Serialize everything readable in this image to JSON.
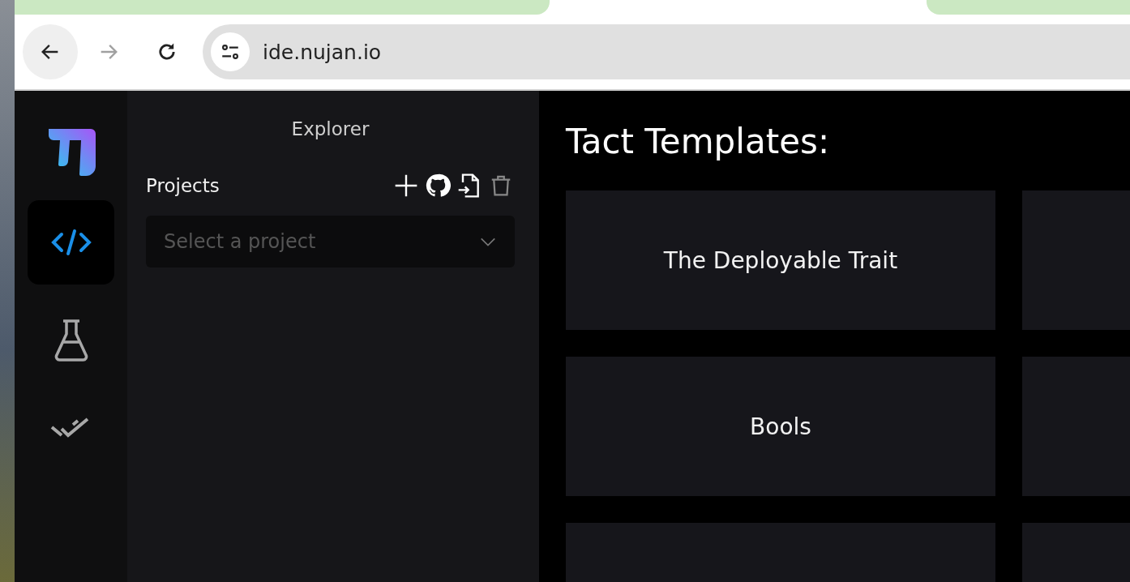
{
  "browser": {
    "back": {
      "disabled": false
    },
    "forward": {
      "disabled": true
    },
    "url": "ide.nujan.io"
  },
  "rail": {
    "items": [
      {
        "kind": "code",
        "selected": true
      },
      {
        "kind": "test",
        "selected": false
      },
      {
        "kind": "check",
        "selected": false
      }
    ]
  },
  "explorer": {
    "title": "Explorer",
    "projects_label": "Projects",
    "project_select": {
      "placeholder": "Select a project"
    }
  },
  "main": {
    "title": "Tact Templates:",
    "templates": [
      {
        "kind": "titled",
        "title": "The Deployable Trait"
      },
      {
        "kind": "untitled"
      },
      {
        "kind": "titled",
        "title": "Bools"
      },
      {
        "kind": "untitled"
      },
      {
        "kind": "untitled"
      },
      {
        "kind": "untitled"
      }
    ]
  }
}
